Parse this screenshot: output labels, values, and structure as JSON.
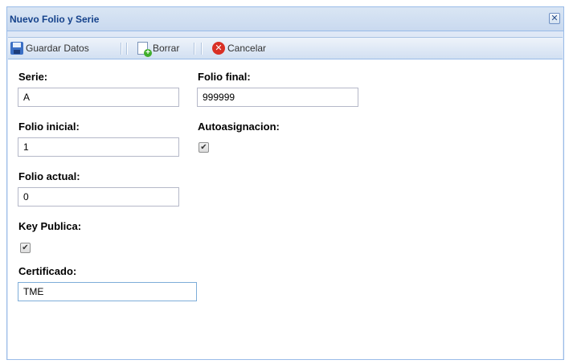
{
  "window": {
    "title": "Nuevo Folio y Serie",
    "close_glyph": "✕"
  },
  "toolbar": {
    "save_label": "Guardar Datos",
    "clear_label": "Borrar",
    "cancel_label": "Cancelar"
  },
  "form": {
    "serie": {
      "label": "Serie:",
      "value": "A"
    },
    "folio_final": {
      "label": "Folio final:",
      "value": "999999"
    },
    "folio_inicial": {
      "label": "Folio inicial:",
      "value": "1"
    },
    "autoasignacion": {
      "label": "Autoasignacion:",
      "checked": true,
      "check_glyph": "✔"
    },
    "folio_actual": {
      "label": "Folio actual:",
      "value": "0"
    },
    "key_publica": {
      "label": "Key Publica:",
      "checked": true,
      "check_glyph": "✔"
    },
    "certificado": {
      "label": "Certificado:",
      "value": "TME"
    }
  },
  "colors": {
    "title_text": "#15428b",
    "border": "#99bbe8",
    "frame_bg": "#dfe8f6",
    "cancel_icon": "#d93025"
  }
}
